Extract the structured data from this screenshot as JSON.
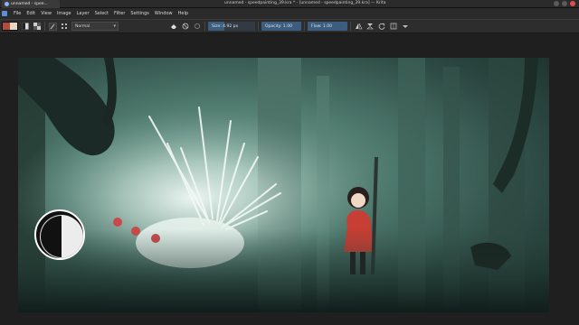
{
  "window": {
    "tab_label": "unnamed - spee...",
    "title": "unnamed - speedpainting_39.kra * - [unnamed - speedpainting_39.kra] — Krita"
  },
  "menu": {
    "items": [
      "File",
      "Edit",
      "View",
      "Image",
      "Layer",
      "Select",
      "Filter",
      "Settings",
      "Window",
      "Help"
    ]
  },
  "toolbar": {
    "blend_mode": "Normal",
    "size_label": "Size:  4.92 px",
    "size_fraction": 0.35,
    "opacity_label": "Opacity:  1.00",
    "opacity_fraction": 1.0,
    "flow_label": "Flow:  1.00",
    "flow_fraction": 1.0
  },
  "icons": {
    "app": "krita-logo-icon",
    "brush_preset": "brush-preset-icon",
    "eraser": "eraser-icon",
    "mirror": "mirror-icon",
    "reload": "reload-icon",
    "wrap": "wrap-icon"
  },
  "colors": {
    "foreground": "#b34b3d",
    "background": "#e8d7c0",
    "accent": "#3d5d7e"
  }
}
